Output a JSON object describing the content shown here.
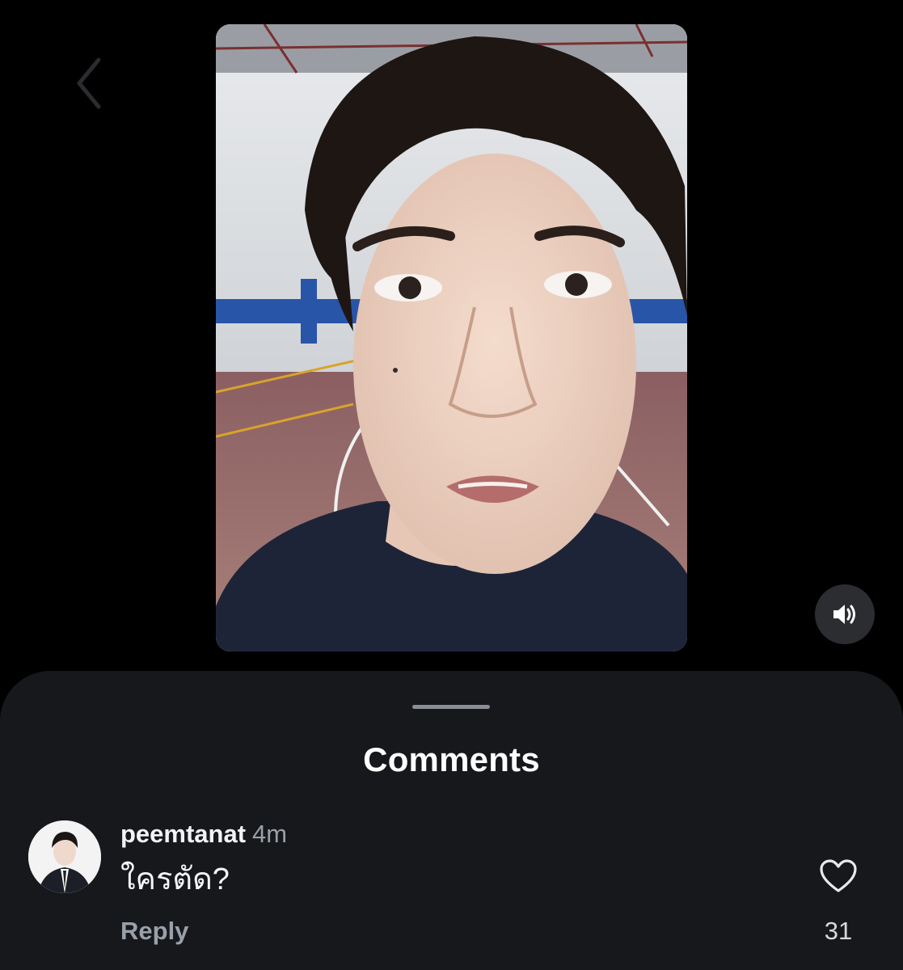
{
  "navigation": {
    "back_icon": "chevron-left-icon"
  },
  "video": {
    "description_icon": "video-thumbnail",
    "mute_icon": "speaker-volume-icon"
  },
  "comments_sheet": {
    "title": "Comments",
    "comments": [
      {
        "username": "peemtanat",
        "time": "4m",
        "text": "ใครตัด?",
        "reply_label": "Reply",
        "like_icon": "heart-outline-icon",
        "like_count": "31"
      }
    ]
  },
  "colors": {
    "background": "#000000",
    "sheet_background": "#16181c",
    "primary_text": "#ffffff",
    "secondary_text": "#9aa0a8"
  }
}
